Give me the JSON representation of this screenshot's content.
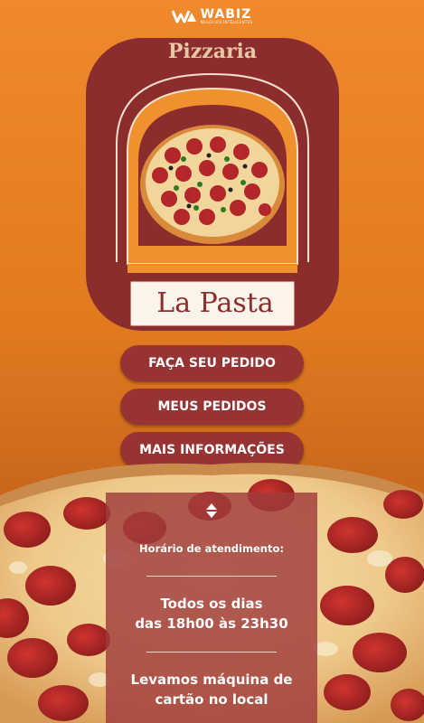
{
  "brand": {
    "name": "WABIZ",
    "tagline": "NEGÓCIOS INTELIGENTES"
  },
  "logo": {
    "title": "Pizzaria",
    "name": "La Pasta"
  },
  "menu": {
    "order_label": "FAÇA SEU PEDIDO",
    "my_orders_label": "MEUS PEDIDOS",
    "more_info_label": "MAIS INFORMAÇÕES"
  },
  "info": {
    "hours_label": "Horário de atendimento:",
    "days_line1": "Todos os dias",
    "days_line2": "das 18h00 às 23h30",
    "card_line1": "Levamos máquina de",
    "card_line2": "cartão no local"
  },
  "colors": {
    "accent": "#973332",
    "panel": "#a03c3c",
    "logo_frame": "#8b2d2d",
    "background": "#f0892d"
  },
  "icons": [
    "wabiz-logo-icon",
    "pizza-illustration",
    "up-down-arrows-icon"
  ]
}
